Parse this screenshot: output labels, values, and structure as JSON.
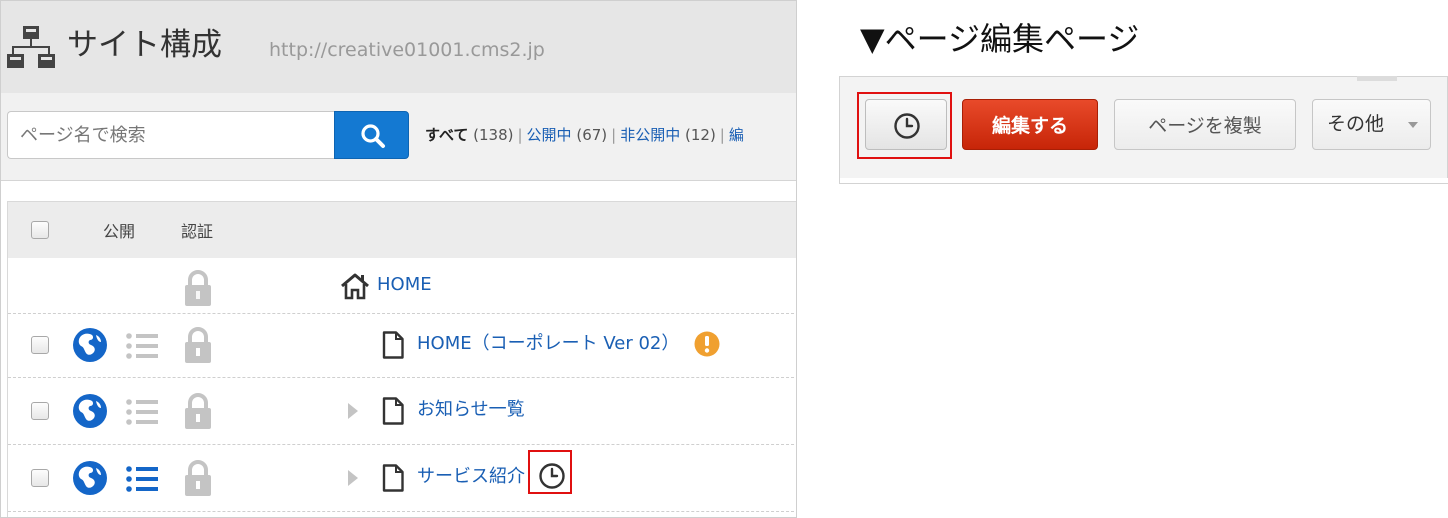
{
  "site_structure": {
    "title": "サイト構成",
    "url": "http://creative01001.cms2.jp",
    "search": {
      "placeholder": "ページ名で検索"
    },
    "filters": {
      "all_label": "すべて",
      "all_count": "(138)",
      "published_label": "公開中",
      "published_count": "(67)",
      "unpublished_label": "非公開中",
      "unpublished_count": "(12)",
      "truncated_label": "編"
    },
    "table": {
      "headers": {
        "public": "公開",
        "auth": "認証"
      },
      "rows": [
        {
          "title": "HOME",
          "icon": "home-icon"
        },
        {
          "title": "HOME（コーポレート Ver 02）",
          "icon": "document-icon",
          "badge": "warning-icon"
        },
        {
          "title": "お知らせ一覧",
          "icon": "document-icon"
        },
        {
          "title": "サービス紹介",
          "icon": "document-icon",
          "badge": "clock-icon"
        }
      ]
    }
  },
  "edit_page": {
    "heading": "▼ページ編集ページ",
    "buttons": {
      "edit": "編集する",
      "duplicate": "ページを複製",
      "more": "その他"
    }
  },
  "colors": {
    "link": "#1a5fb4",
    "search_button": "#1479d2",
    "edit_button": "#d83515",
    "highlight": "#e01010",
    "warning": "#f0a030"
  }
}
